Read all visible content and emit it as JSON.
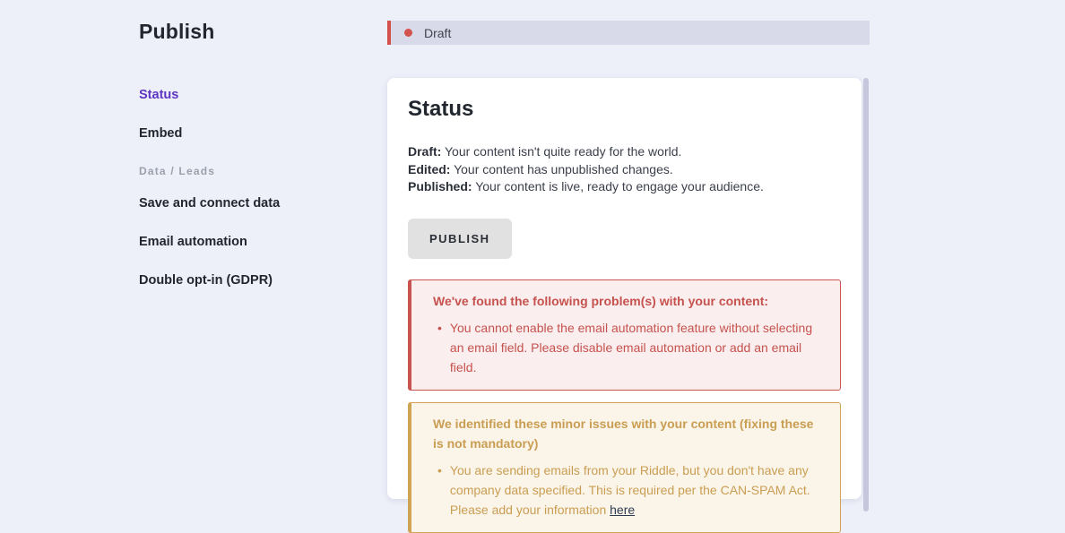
{
  "sidebar": {
    "title": "Publish",
    "items": {
      "status": "Status",
      "embed": "Embed",
      "section_data_leads": "Data / Leads",
      "save_connect": "Save and connect data",
      "email_automation": "Email automation",
      "double_optin": "Double opt-in (GDPR)"
    }
  },
  "statusbar": {
    "label": "Draft",
    "dot_color": "#d4524e",
    "bg_color": "#d9dae9"
  },
  "main": {
    "heading": "Status",
    "description": {
      "draft_label": "Draft:",
      "draft_text": " Your content isn't quite ready for the world.",
      "edited_label": "Edited:",
      "edited_text": " Your content has unpublished changes.",
      "published_label": "Published:",
      "published_text": " Your content is live, ready to engage your audience."
    },
    "publish_button": "PUBLISH",
    "error_alert": {
      "title": "We've found the following problem(s) with your content:",
      "bullet": "•",
      "item": "You cannot enable the email automation feature without selecting an email field. Please disable email automation or add an email field.",
      "accent_color": "#c9534f",
      "bg_color": "#fbeeee"
    },
    "warning_alert": {
      "title": "We identified these minor issues with your content (fixing these is not mandatory)",
      "bullet": "•",
      "item_text": "You are sending emails from your Riddle, but you don't have any company data specified. This is required per the CAN-SPAM Act. Please add your information ",
      "item_link": "here",
      "accent_color": "#d0a454",
      "bg_color": "#fbf4e9",
      "link_color": "#2d3a52"
    }
  }
}
